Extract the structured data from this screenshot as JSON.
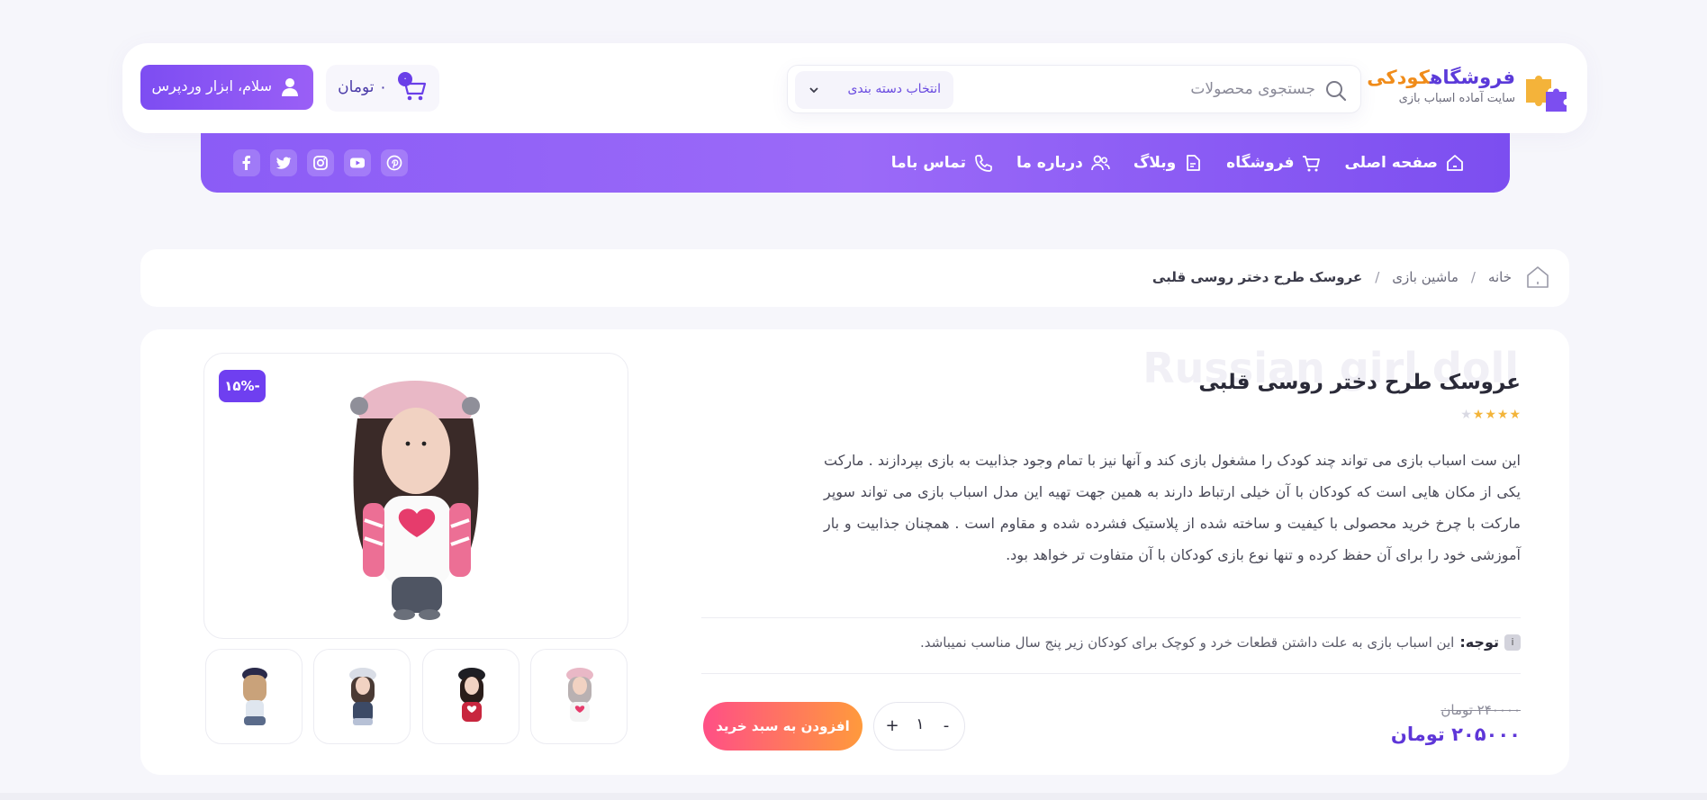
{
  "header": {
    "logo": {
      "title_main": "فروشگاه",
      "title_accent": "کودکی",
      "subtitle": "سایت آماده اسباب بازی"
    },
    "search": {
      "placeholder": "جستجوی محصولات",
      "category_label": "انتخاب دسته بندی"
    },
    "cart": {
      "count": "۰",
      "total": "۰ تومان"
    },
    "user": {
      "label": "سلام، ابزار وردپرس"
    }
  },
  "nav": {
    "items": [
      {
        "label": "صفحه اصلی",
        "icon": "home-icon"
      },
      {
        "label": "فروشگاه",
        "icon": "cart-icon"
      },
      {
        "label": "وبلاگ",
        "icon": "document-icon"
      },
      {
        "label": "درباره ما",
        "icon": "users-icon"
      },
      {
        "label": "تماس باما",
        "icon": "phone-icon"
      }
    ],
    "socials": [
      "facebook-icon",
      "twitter-icon",
      "instagram-icon",
      "youtube-icon",
      "pinterest-icon"
    ]
  },
  "breadcrumb": {
    "items": [
      "خانه",
      "ماشین بازی",
      "عروسک طرح دختر روسی قلبی"
    ],
    "separator": "/"
  },
  "product": {
    "ghost_title": "Russian girl doll",
    "title": "عروسک طرح دختر روسی قلبی",
    "rating": 4.5,
    "description": "این ست اسباب بازی می تواند چند کودک را مشغول بازی کند و آنها نیز با تمام وجود جذابیت به بازی بپردازند . مارکت یکی از مکان هایی است که کودکان با آن خیلی ارتباط دارند به همین جهت تهیه این مدل اسباب بازی می تواند سوپر مارکت با چرخ خرید محصولی با کیفیت و ساخته شده از پلاستیک فشرده شده و مقاوم است . همچنان جذابیت و بار آموزشی خود را برای آن حفظ کرده و تنها نوع بازی کودکان با آن متفاوت تر خواهد بود.",
    "note_label": "توجه:",
    "note_icon_text": "i",
    "note_text": "این اسباب بازی به علت داشتن قطعات خرد و کوچک برای کودکان زیر پنج سال مناسب نمیباشد.",
    "old_price": "۲۴۰۰۰۰ تومان",
    "new_price": "۲۰۵۰۰۰ تومان",
    "quantity": "۱",
    "plus": "+",
    "minus": "-",
    "add_to_cart": "افزودن به سبد خرید",
    "discount": "-۱۵%"
  },
  "colors": {
    "primary": "#7c4ef0",
    "accent_orange": "#f08c1a",
    "price": "#5e36d8",
    "cta_start": "#ff4f86",
    "cta_end": "#ff9a3c"
  }
}
